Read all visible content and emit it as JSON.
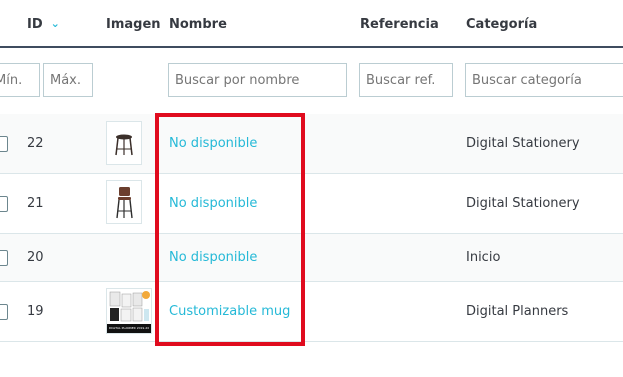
{
  "header": {
    "id_label": "ID",
    "image_label": "Imagen",
    "name_label": "Nombre",
    "reference_label": "Referencia",
    "category_label": "Categoría"
  },
  "filters": {
    "id_min_placeholder": "Mín.",
    "id_max_placeholder": "Máx.",
    "name_placeholder": "Buscar por nombre",
    "reference_placeholder": "Buscar ref.",
    "category_placeholder": "Buscar categoría"
  },
  "rows": [
    {
      "id": "22",
      "name": "No disponible",
      "reference": "",
      "category": "Digital Stationery",
      "image": "stool-icon"
    },
    {
      "id": "21",
      "name": "No disponible",
      "reference": "",
      "category": "Digital Stationery",
      "image": "bar-chair-icon"
    },
    {
      "id": "20",
      "name": "No disponible",
      "reference": "",
      "category": "Inicio",
      "image": ""
    },
    {
      "id": "19",
      "name": "Customizable mug",
      "reference": "",
      "category": "Digital Planners",
      "image": "planner-thumbnail",
      "image_caption": "DIGITAL PLANNER 2019-2020"
    }
  ],
  "colors": {
    "link": "#25b9d7",
    "highlight": "#e00b1e",
    "header_border": "#3f4c5f"
  }
}
